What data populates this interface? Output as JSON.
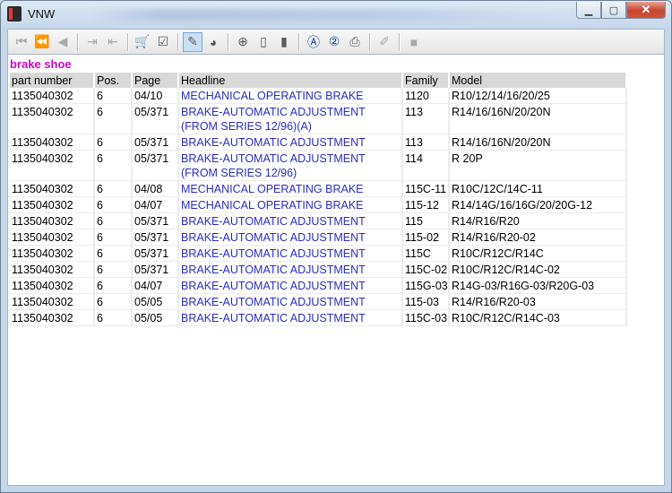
{
  "window": {
    "title": "VNW"
  },
  "toolbar": {
    "buttons": [
      {
        "name": "first-record-icon",
        "glyph": "⏮",
        "state": "disabled"
      },
      {
        "name": "previous-page-icon",
        "glyph": "⏪",
        "state": "disabled"
      },
      {
        "name": "previous-record-icon",
        "glyph": "◀",
        "state": "disabled"
      },
      {
        "name": "export-icon",
        "glyph": "⇥",
        "state": "disabled"
      },
      {
        "name": "import-icon",
        "glyph": "⇤",
        "state": "disabled"
      },
      {
        "name": "cart-icon",
        "glyph": "🛒",
        "state": "normal"
      },
      {
        "name": "checklist-icon",
        "glyph": "☑",
        "state": "normal"
      },
      {
        "name": "tag-filter-icon",
        "glyph": "✎",
        "state": "active"
      },
      {
        "name": "globe-icon",
        "glyph": "◕",
        "state": "normal"
      },
      {
        "name": "zoom-in-icon",
        "glyph": "⊕",
        "state": "normal"
      },
      {
        "name": "page-icon",
        "glyph": "▯",
        "state": "normal"
      },
      {
        "name": "page-alt-icon",
        "glyph": "▮",
        "state": "normal"
      },
      {
        "name": "circle-a-icon",
        "glyph": "Ⓐ",
        "state": "blue"
      },
      {
        "name": "circle-2-icon",
        "glyph": "②",
        "state": "blue"
      },
      {
        "name": "print-icon",
        "glyph": "⎙",
        "state": "normal"
      },
      {
        "name": "eraser-icon",
        "glyph": "✐",
        "state": "disabled"
      },
      {
        "name": "stop-icon",
        "glyph": "■",
        "state": "disabled"
      }
    ]
  },
  "section_title": "brake shoe",
  "table": {
    "headers": [
      "part number",
      "Pos.",
      "Page",
      "Headline",
      "Family",
      "Model"
    ],
    "rows": [
      [
        "1135040302",
        "6",
        "04/10",
        "MECHANICAL OPERATING BRAKE",
        "1120",
        "R10/12/14/16/20/25"
      ],
      [
        "1135040302",
        "6",
        "05/371",
        "BRAKE-AUTOMATIC ADJUSTMENT (FROM SERIES 12/96)(A)",
        "113",
        "R14/16/16N/20/20N"
      ],
      [
        "1135040302",
        "6",
        "05/371",
        "BRAKE-AUTOMATIC ADJUSTMENT",
        "113",
        "R14/16/16N/20/20N"
      ],
      [
        "1135040302",
        "6",
        "05/371",
        "BRAKE-AUTOMATIC ADJUSTMENT (FROM SERIES 12/96)",
        "114",
        "R 20P"
      ],
      [
        "1135040302",
        "6",
        "04/08",
        "MECHANICAL OPERATING BRAKE",
        "115C-11",
        "R10C/12C/14C-11"
      ],
      [
        "1135040302",
        "6",
        "04/07",
        "MECHANICAL OPERATING BRAKE",
        "115-12",
        "R14/14G/16/16G/20/20G-12"
      ],
      [
        "1135040302",
        "6",
        "05/371",
        "BRAKE-AUTOMATIC ADJUSTMENT",
        "115",
        "R14/R16/R20"
      ],
      [
        "1135040302",
        "6",
        "05/371",
        "BRAKE-AUTOMATIC ADJUSTMENT",
        "115-02",
        "R14/R16/R20-02"
      ],
      [
        "1135040302",
        "6",
        "05/371",
        "BRAKE-AUTOMATIC ADJUSTMENT",
        "115C",
        "R10C/R12C/R14C"
      ],
      [
        "1135040302",
        "6",
        "05/371",
        "BRAKE-AUTOMATIC ADJUSTMENT",
        "115C-02",
        "R10C/R12C/R14C-02"
      ],
      [
        "1135040302",
        "6",
        "04/07",
        "BRAKE-AUTOMATIC ADJUSTMENT",
        "115G-03",
        "R14G-03/R16G-03/R20G-03"
      ],
      [
        "1135040302",
        "6",
        "05/05",
        "BRAKE-AUTOMATIC ADJUSTMENT",
        "115-03",
        "R14/R16/R20-03"
      ],
      [
        "1135040302",
        "6",
        "05/05",
        "BRAKE-AUTOMATIC ADJUSTMENT",
        "115C-03",
        "R10C/R12C/R14C-03"
      ]
    ]
  }
}
